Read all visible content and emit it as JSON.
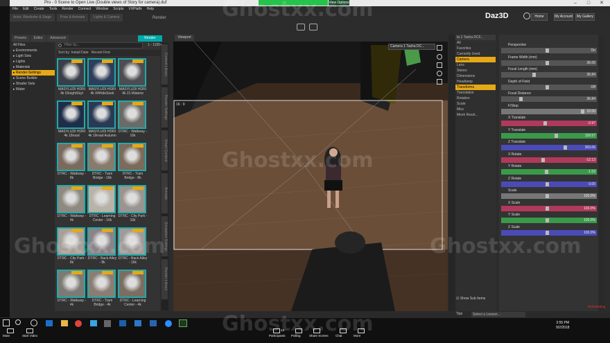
{
  "window": {
    "title": "Pro - 0 Scene to Open Live (Double views of Story for camera).duf",
    "meeting_banner_label": "View Options"
  },
  "menu": [
    "File",
    "Edit",
    "Create",
    "Tools",
    "Render",
    "Connect",
    "Window",
    "Scripts",
    "VXPlatfx",
    "Help"
  ],
  "top_tabs": [
    "Actor, Wardrobe & Stage",
    "Pose & Animate",
    "Lights & Camera"
  ],
  "render_tab": "Render",
  "brand": {
    "logo": "Daz3D",
    "home": "Home",
    "account": "My Account",
    "gallery": "My Gallery"
  },
  "library": {
    "tabs": [
      "Presets",
      "Editor",
      "Advanced"
    ],
    "render_button": "Render",
    "tree": [
      {
        "label": "All Files",
        "sel": false
      },
      {
        "label": "▸ Environments",
        "sel": false
      },
      {
        "label": "▸ Light Sets",
        "sel": false
      },
      {
        "label": "▸ Lights",
        "sel": false
      },
      {
        "label": "▸ Materials",
        "sel": false
      },
      {
        "label": "▸ Render-Settings",
        "sel": true
      },
      {
        "label": "▸ Scene Builder",
        "sel": false
      },
      {
        "label": "▸ Shader Sets",
        "sel": false
      },
      {
        "label": "▸ Water",
        "sel": false
      }
    ],
    "search_placeholder": "Filter by...",
    "range": "1 - 1195+",
    "sort": "Sort by: Install Date",
    "sort_value": "Recent First",
    "items": [
      "MASYLUDI HDRI 4k 03nightSkyt",
      "MASYLUDI HDRI 4k 04HideSeek",
      "MASYLUDI HDRI 4k 21-Waterw",
      "MASYLUDI HDRI 4k 18road",
      "MASYLUDI HDRI 4k 19road Autumn",
      "DTRC - Walkway - 16k",
      "DTRC - Walkway - 8k",
      "DTRC - Tram Bridge - 16k",
      "DTRC - Tram Bridge - 8k",
      "DTRC - Walkway - 4k",
      "DTRC - Learning Center - 16k",
      "DTRC - City Park - 16k",
      "DTRC - City Park - 8k",
      "DTRC - Back Alley - 8k",
      "DTRC - Back Alley - 16k",
      "DTRC - Walkway - 4k",
      "DTRC - Tram Bridge - 4k",
      "DTRC - Learning Center - 4k"
    ]
  },
  "side_vtabs": [
    "Content Library",
    "Render Settings",
    "Smart Content",
    "Animate",
    "Simulation Settings",
    "Render Library"
  ],
  "viewport": {
    "tab": "Viewport",
    "camera": "Camera 1 Tasha DC...",
    "ratio": "16 : 9"
  },
  "scene": {
    "header": "ta 1 Tasha DCF...",
    "items": [
      {
        "label": "All",
        "sel": false
      },
      {
        "label": "Favorites",
        "sel": false
      },
      {
        "label": "Currently Used",
        "sel": false
      },
      {
        "label": "Camera",
        "sel": true
      },
      {
        "label": "Lens",
        "sel": false
      },
      {
        "label": "Stereo",
        "sel": false
      },
      {
        "label": "Dimensions",
        "sel": false
      },
      {
        "label": "Headlamp",
        "sel": false
      },
      {
        "label": "Transforms",
        "sel": true
      },
      {
        "label": "Translation",
        "sel": false
      },
      {
        "label": "Rotation",
        "sel": false
      },
      {
        "label": "Scale",
        "sel": false
      },
      {
        "label": "Misc",
        "sel": false
      },
      {
        "label": "Mesh Resol...",
        "sel": false
      }
    ],
    "show_sub": "Show Sub Items"
  },
  "params": [
    {
      "label": "Perspective",
      "value": "On",
      "color": "#555",
      "level": 0.5
    },
    {
      "label": "Frame Width (mm)",
      "value": "36.00",
      "color": "#555",
      "level": 0.5
    },
    {
      "label": "Focal Length (mm)",
      "value": "36.84",
      "color": "#555",
      "level": 0.35
    },
    {
      "label": "Depth of Field",
      "value": "Off",
      "color": "#555",
      "level": 0.5
    },
    {
      "label": "Focal Distance",
      "value": "36.84",
      "color": "#555",
      "level": 0.2
    },
    {
      "label": "F/Stop",
      "value": "22.00",
      "color": "#777",
      "level": 0.9
    },
    {
      "label": "X Translate",
      "value": "-0.97",
      "color": "#b03a5c",
      "level": 0.48
    },
    {
      "label": "Y Translate",
      "value": "159.57",
      "color": "#3a9a4a",
      "level": 0.6
    },
    {
      "label": "Z Translate",
      "value": "303.06",
      "color": "#4b4bb8",
      "level": 0.7
    },
    {
      "label": "X Rotate",
      "value": "-12.13",
      "color": "#b03a5c",
      "level": 0.45
    },
    {
      "label": "Y Rotate",
      "value": "-1.53",
      "color": "#3a9a4a",
      "level": 0.49
    },
    {
      "label": "Z Rotate",
      "value": "0.00",
      "color": "#4b4bb8",
      "level": 0.5
    },
    {
      "label": "Scale",
      "value": "100.0%",
      "color": "#777",
      "level": 0.5
    },
    {
      "label": "X Scale",
      "value": "100.0%",
      "color": "#b03a5c",
      "level": 0.5
    },
    {
      "label": "Y Scale",
      "value": "100.0%",
      "color": "#3a9a4a",
      "level": 0.5
    },
    {
      "label": "Z Scale",
      "value": "100.0%",
      "color": "#4b4bb8",
      "level": 0.5
    }
  ],
  "bottom": {
    "tips": "Tips",
    "lesson": "Select a Lesson..."
  },
  "taskbar": {
    "time": "3:55 PM",
    "date": "9/2/2018",
    "zoom": [
      "Mute",
      "Start Video",
      "Participants",
      "Polling",
      "Share Screen",
      "Chat",
      "More"
    ],
    "participants_count": "13",
    "end": "End Meeting"
  },
  "watermark": "Ghostxx.com",
  "colors": {
    "accent": "#e6a817",
    "teal": "#22aaaa"
  }
}
